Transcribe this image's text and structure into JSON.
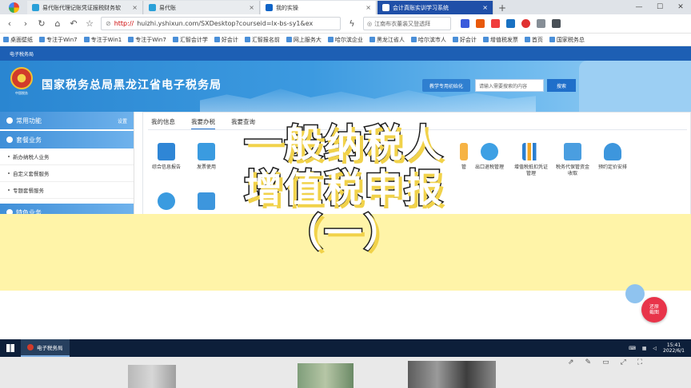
{
  "browser": {
    "tabs": [
      {
        "label": "易代账代理记账凭证报税财务软",
        "active": false
      },
      {
        "label": "易代账",
        "active": false
      },
      {
        "label": "我的实操",
        "active": false
      },
      {
        "label": "会计真账实训学习系统",
        "active": true
      }
    ],
    "new_tab": "+",
    "close": "×",
    "url_prefix": "http://",
    "url_rest": "huizhi.yshixun.com/SXDesktop?courseid=lx-bs-sy1&ex",
    "search_text": "江南布衣董装又登透拜",
    "bookmarks": [
      "桌面壁纸",
      "专注于Win7",
      "专注于Win1",
      "专注于Win7",
      "汇智会计学",
      "好会计",
      "汇智报名前",
      "网上服务大",
      "哈尔滨企业",
      "黑龙江省人",
      "哈尔滨市人",
      "好会计",
      "增值税发票",
      "首页",
      "国家税务总"
    ]
  },
  "site": {
    "topstrip": "电子税务局",
    "emblem_caption": "中国税务",
    "title": "国家税务总局黑龙江省电子税务局",
    "init_button": "教学专用初始化",
    "search_placeholder": "请输入需要搜索的内容",
    "search_button": "搜索"
  },
  "sidebar": {
    "common": {
      "label": "常用功能",
      "right": "设置"
    },
    "package": {
      "label": "套餐业务"
    },
    "items": [
      "新办纳税人业务",
      "自定义套餐服务",
      "专题套餐服务"
    ],
    "special": {
      "label": "特色业务"
    }
  },
  "main": {
    "tabs": [
      "我的信息",
      "我要办税",
      "我要查询"
    ],
    "tiles": [
      {
        "label": "综合信息报告",
        "color": "#2f86d6"
      },
      {
        "label": "发票使用",
        "color": "#3a9be0"
      },
      {
        "label": "出口退税管理",
        "color": "#3ea0e4"
      },
      {
        "label": "增值税抵扣凭证管理",
        "color": "#2b7fd0"
      },
      {
        "label": "税务代保管资金收取",
        "color": "#4a9ee0"
      },
      {
        "label": "预约定价安排",
        "color": "#3d96dd"
      },
      {
        "label": "",
        "color": "#3a9be0"
      },
      {
        "label": "",
        "color": "#3d96dd"
      }
    ],
    "partial_label": "管"
  },
  "overlay": {
    "line1": "一般纳税人",
    "line2": "增值税申报",
    "line3": "（一）"
  },
  "float_button": "还原\n截图",
  "taskbar": {
    "app": "电子税务局",
    "time": "15:41",
    "date": "2022/6/1"
  },
  "colors": {
    "header_blue": "#1d5fb4",
    "accent_yellow": "#fff4a8",
    "float_red": "#e8344a"
  }
}
